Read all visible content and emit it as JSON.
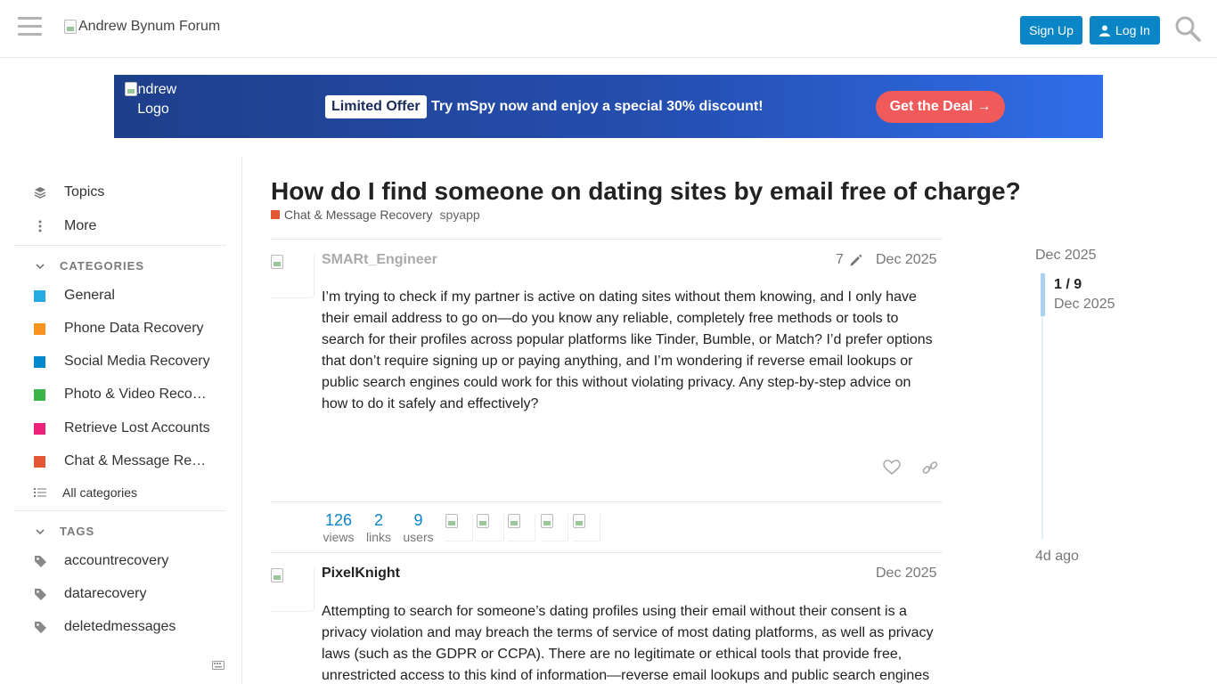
{
  "header": {
    "logo_alt": "Andrew Bynum Forum",
    "signup_label": "Sign Up",
    "login_label": "Log In"
  },
  "banner": {
    "logo_alt": "andrew Logo",
    "badge": "Limited Offer",
    "text": "Try mSpy now and enjoy a special 30% discount!",
    "cta": "Get the Deal →",
    "colors": {
      "bg_start": "#1e3f8a",
      "bg_end": "#2f6ee9",
      "cta": "#f05a5a"
    }
  },
  "sidebar": {
    "topics": "Topics",
    "more": "More",
    "categories_heading": "CATEGORIES",
    "categories": [
      {
        "label": "General",
        "color": "#25aae1"
      },
      {
        "label": "Phone Data Recovery",
        "color": "#f7941d"
      },
      {
        "label": "Social Media Recovery",
        "color": "#0088cc"
      },
      {
        "label": "Photo & Video Reco…",
        "color": "#3ab54a"
      },
      {
        "label": "Retrieve Lost Accounts",
        "color": "#ed207b"
      },
      {
        "label": "Chat & Message Re…",
        "color": "#e45735"
      }
    ],
    "all_categories": "All categories",
    "tags_heading": "TAGS",
    "tags": [
      "accountrecovery",
      "datarecovery",
      "deletedmessages"
    ]
  },
  "topic": {
    "title": "How do I find someone on dating sites by email free of charge?",
    "category": "Chat & Message Recovery",
    "tag": "spyapp"
  },
  "posts": [
    {
      "author": "SMARt_Engineer",
      "edits": "7",
      "date": "Dec 2025",
      "body": "I’m trying to check if my partner is active on dating sites without them knowing, and I only have their email address to go on—do you know any reliable, completely free methods or tools to search for their profiles across popular platforms like Tinder, Bumble, or Match? I’d prefer options that don’t require signing up or paying anything, and I’m wondering if reverse email lookups or public search engines could work for this without violating privacy. Any step-by-step advice on how to do it safely and effectively?"
    },
    {
      "author": "PixelKnight",
      "date": "Dec 2025",
      "body": "Attempting to search for someone’s dating profiles using their email without their consent is a privacy violation and may breach the terms of service of most dating platforms, as well as privacy laws (such as the GDPR or CCPA). There are no legitimate or ethical tools that provide free, unrestricted access to this kind of information—reverse email lookups and public search engines"
    }
  ],
  "stats": {
    "views": "126",
    "views_label": "views",
    "links": "2",
    "links_label": "links",
    "users": "9",
    "users_label": "users"
  },
  "timeline": {
    "top_date": "Dec 2025",
    "position": "1 / 9",
    "position_date": "Dec 2025",
    "bottom": "4d ago"
  }
}
